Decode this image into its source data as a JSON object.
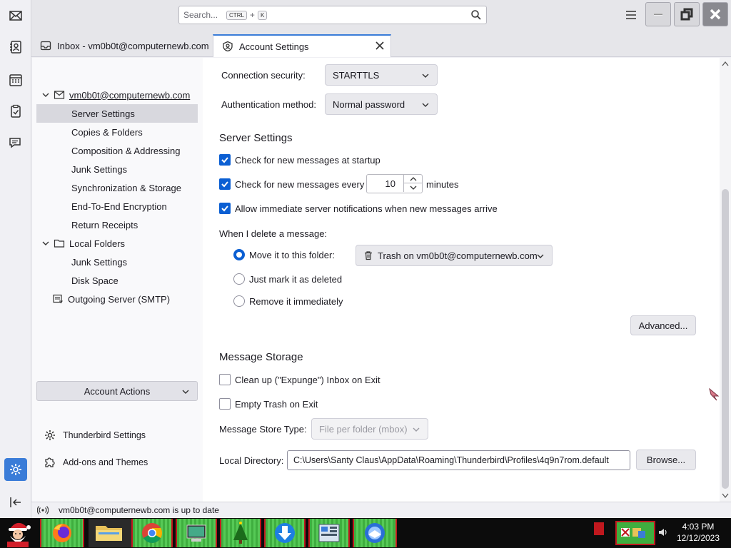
{
  "titlebar": {
    "search_placeholder": "Search...",
    "search_key1": "CTRL",
    "search_plus": "+",
    "search_key2": "K"
  },
  "tabs": [
    {
      "label": "Inbox - vm0b0t@computernewb.com"
    },
    {
      "label": "Account Settings"
    }
  ],
  "sidebar": {
    "account": "vm0b0t@computernewb.com",
    "account_items": [
      {
        "label": "Server Settings"
      },
      {
        "label": "Copies & Folders"
      },
      {
        "label": "Composition & Addressing"
      },
      {
        "label": "Junk Settings"
      },
      {
        "label": "Synchronization & Storage"
      },
      {
        "label": "End-To-End Encryption"
      },
      {
        "label": "Return Receipts"
      }
    ],
    "local_folders": "Local Folders",
    "local_items": [
      {
        "label": "Junk Settings"
      },
      {
        "label": "Disk Space"
      }
    ],
    "outgoing": "Outgoing Server (SMTP)",
    "account_actions": "Account Actions",
    "thunderbird_settings": "Thunderbird Settings",
    "addons": "Add-ons and Themes"
  },
  "main": {
    "connection_security_label": "Connection security:",
    "connection_security_value": "STARTTLS",
    "auth_label": "Authentication method:",
    "auth_value": "Normal password",
    "server_settings_title": "Server Settings",
    "check_startup": "Check for new messages at startup",
    "check_every": "Check for new messages every",
    "check_every_value": "10",
    "minutes": "minutes",
    "allow_notifications": "Allow immediate server notifications when new messages arrive",
    "delete_label": "When I delete a message:",
    "move_label": "Move it to this folder:",
    "trash_folder": "Trash on vm0b0t@computernewb.com",
    "just_mark": "Just mark it as deleted",
    "remove_immediately": "Remove it immediately",
    "advanced_button": "Advanced...",
    "message_storage_title": "Message Storage",
    "clean_up": "Clean up (\"Expunge\") Inbox on Exit",
    "empty_trash": "Empty Trash on Exit",
    "store_type_label": "Message Store Type:",
    "store_type_value": "File per folder (mbox)",
    "local_dir_label": "Local Directory:",
    "local_dir_value": "C:\\Users\\Santy Claus\\AppData\\Roaming\\Thunderbird\\Profiles\\4q9n7rom.default",
    "browse_button": "Browse..."
  },
  "status": {
    "text": "vm0b0t@computernewb.com is up to date"
  },
  "taskbar": {
    "time": "4:03 PM",
    "date": "12/12/2023"
  },
  "colors": {
    "accent": "#0b5fd3",
    "selected_tab_top": "#3a7cd8",
    "taskbar_green": "#3fae3f",
    "taskbar_red": "#c0181e"
  }
}
